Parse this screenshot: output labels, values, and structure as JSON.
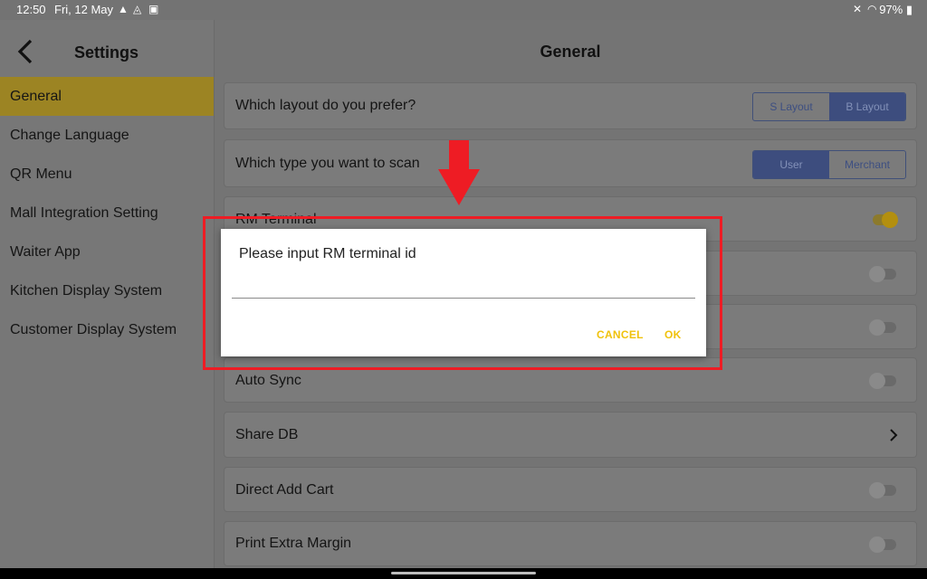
{
  "status_bar": {
    "time": "12:50",
    "date": "Fri, 12 May",
    "battery": "97%"
  },
  "sidebar": {
    "title": "Settings",
    "items": [
      {
        "label": "General",
        "active": true
      },
      {
        "label": "Change Language"
      },
      {
        "label": "QR Menu"
      },
      {
        "label": "Mall Integration Setting"
      },
      {
        "label": "Waiter App"
      },
      {
        "label": "Kitchen Display System"
      },
      {
        "label": "Customer Display System"
      }
    ]
  },
  "main": {
    "title": "General",
    "layout_row": {
      "label": "Which layout do you prefer?",
      "options": [
        "S Layout",
        "B Layout"
      ],
      "selected": "B Layout"
    },
    "scan_row": {
      "label": "Which type you want to scan",
      "options": [
        "User",
        "Merchant"
      ],
      "selected": "User"
    },
    "rows": [
      {
        "label": "RM Terminal",
        "toggle": true
      },
      {
        "label": "Auto Sync",
        "toggle": false
      },
      {
        "label": "Share DB"
      },
      {
        "label": "Direct Add Cart",
        "toggle": false
      },
      {
        "label": "Print Extra Margin",
        "toggle": false
      }
    ]
  },
  "dialog": {
    "title": "Please input RM terminal id",
    "input_value": "",
    "cancel_label": "CANCEL",
    "ok_label": "OK"
  },
  "colors": {
    "accent": "#f0c20c",
    "annotation": "#ee1c24",
    "segment": "#3d4d7e"
  }
}
